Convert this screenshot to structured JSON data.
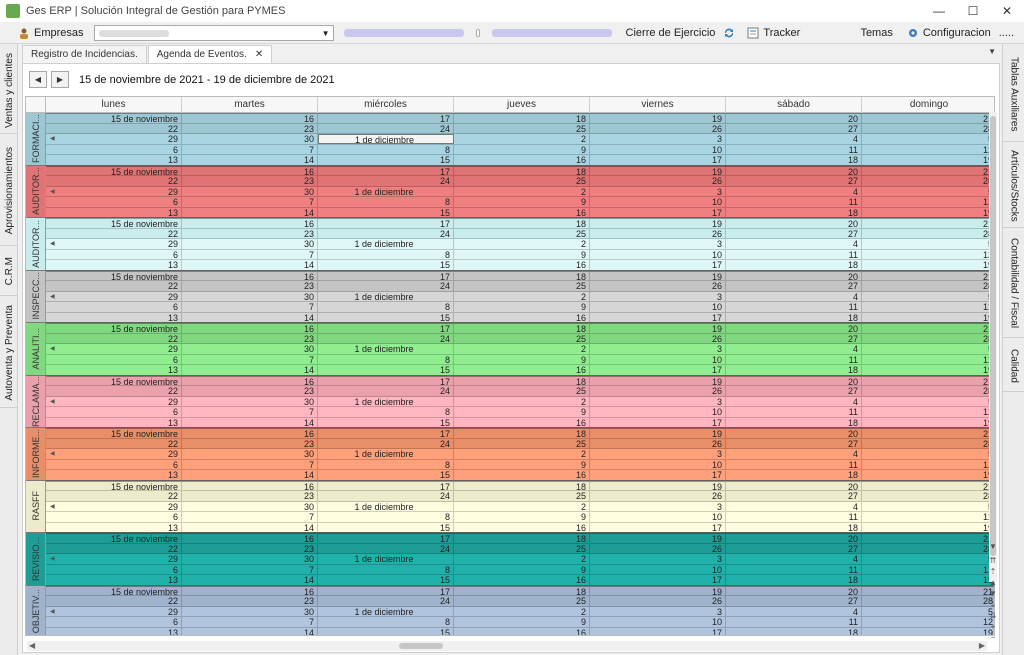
{
  "window": {
    "title": "Ges ERP | Solución Integral de Gestión para PYMES",
    "controls": [
      "—",
      "☐",
      "✕"
    ]
  },
  "toolbar": {
    "empresas_label": "Empresas",
    "cierre_label": "Cierre de Ejercicio",
    "tracker_label": "Tracker",
    "temas_label": "Temas",
    "configuracion_label": "Configuracion",
    "more_label": "....."
  },
  "left_tabs": [
    "Ventas y clientes",
    "Aprovisionamientos",
    "C.R.M",
    "Autoventa y Preventa"
  ],
  "right_tabs": [
    "Tablas Auxiliares",
    "Artículos/Stocks",
    "Contabilidad / Fiscal",
    "Calidad"
  ],
  "doc_tabs": [
    {
      "label": "Registro de Incidencias."
    },
    {
      "label": "Agenda de Eventos."
    }
  ],
  "calendar": {
    "range": "15 de noviembre de 2021 - 19 de diciembre de 2021",
    "days": [
      "lunes",
      "martes",
      "miércoles",
      "jueves",
      "viernes",
      "sábado",
      "domingo"
    ],
    "weeks": [
      [
        "15 de noviembre",
        "16",
        "17",
        "18",
        "19",
        "20",
        "21"
      ],
      [
        "22",
        "23",
        "24",
        "25",
        "26",
        "27",
        "28"
      ],
      [
        "29",
        "30",
        "1 de diciembre",
        "2",
        "3",
        "4",
        "5"
      ],
      [
        "6",
        "7",
        "8",
        "9",
        "10",
        "11",
        "12"
      ],
      [
        "13",
        "14",
        "15",
        "16",
        "17",
        "18",
        "19"
      ]
    ],
    "groups": [
      {
        "label": "FORMACI...",
        "color": "#a9d5e2",
        "head": "#9ec7d4"
      },
      {
        "label": "AUDITOR...",
        "color": "#f08080",
        "head": "#e07373"
      },
      {
        "label": "AUDITOR...",
        "color": "#dff7f7",
        "head": "#c9ecec"
      },
      {
        "label": "INSPECC...",
        "color": "#d6d6d6",
        "head": "#c4c4c4"
      },
      {
        "label": "ANALITI...",
        "color": "#90ee90",
        "head": "#80d880"
      },
      {
        "label": "RECLAMA...",
        "color": "#ffb6c1",
        "head": "#eaa1ac"
      },
      {
        "label": "INFORME...",
        "color": "#ffa07a",
        "head": "#e88e69"
      },
      {
        "label": "RASFF",
        "color": "#fffde0",
        "head": "#ecebcc"
      },
      {
        "label": "REVISIO...",
        "color": "#20b2aa",
        "head": "#1d9d96"
      },
      {
        "label": "OBJETIV...",
        "color": "#b0c4de",
        "head": "#9fb3cc"
      }
    ]
  }
}
